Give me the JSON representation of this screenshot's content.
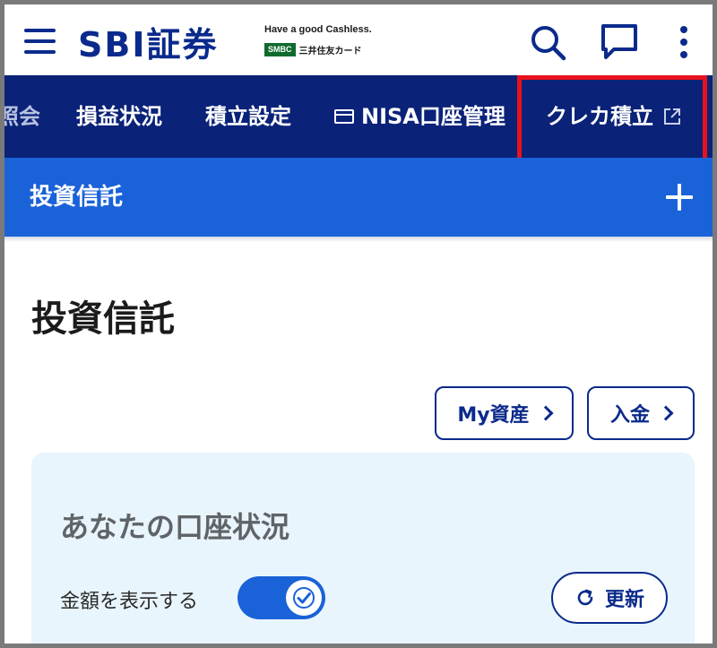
{
  "header": {
    "logo_text": "SBI証券",
    "tagline": "Have a good Cashless.",
    "smbc_badge": "SMBC",
    "smbc_text": "三井住友カード"
  },
  "nav": {
    "items": [
      {
        "label": "照会"
      },
      {
        "label": "損益状況"
      },
      {
        "label": "積立設定"
      },
      {
        "label": "NISA口座管理"
      },
      {
        "label": "クレカ積立"
      }
    ],
    "highlight_color": "#e8121c"
  },
  "fund_bar": {
    "title": "投資信託"
  },
  "page": {
    "title": "投資信託",
    "buttons": {
      "my_assets": "My資産",
      "deposit": "入金"
    },
    "account": {
      "title": "あなたの口座状況",
      "toggle_label": "金額を表示する",
      "toggle_on": true,
      "refresh_label": "更新"
    }
  },
  "colors": {
    "brand_navy": "#0a2a8c",
    "nav_bg": "#0a2278",
    "fund_bar_bg": "#1a62d8",
    "card_bg": "#e9f5fc"
  }
}
